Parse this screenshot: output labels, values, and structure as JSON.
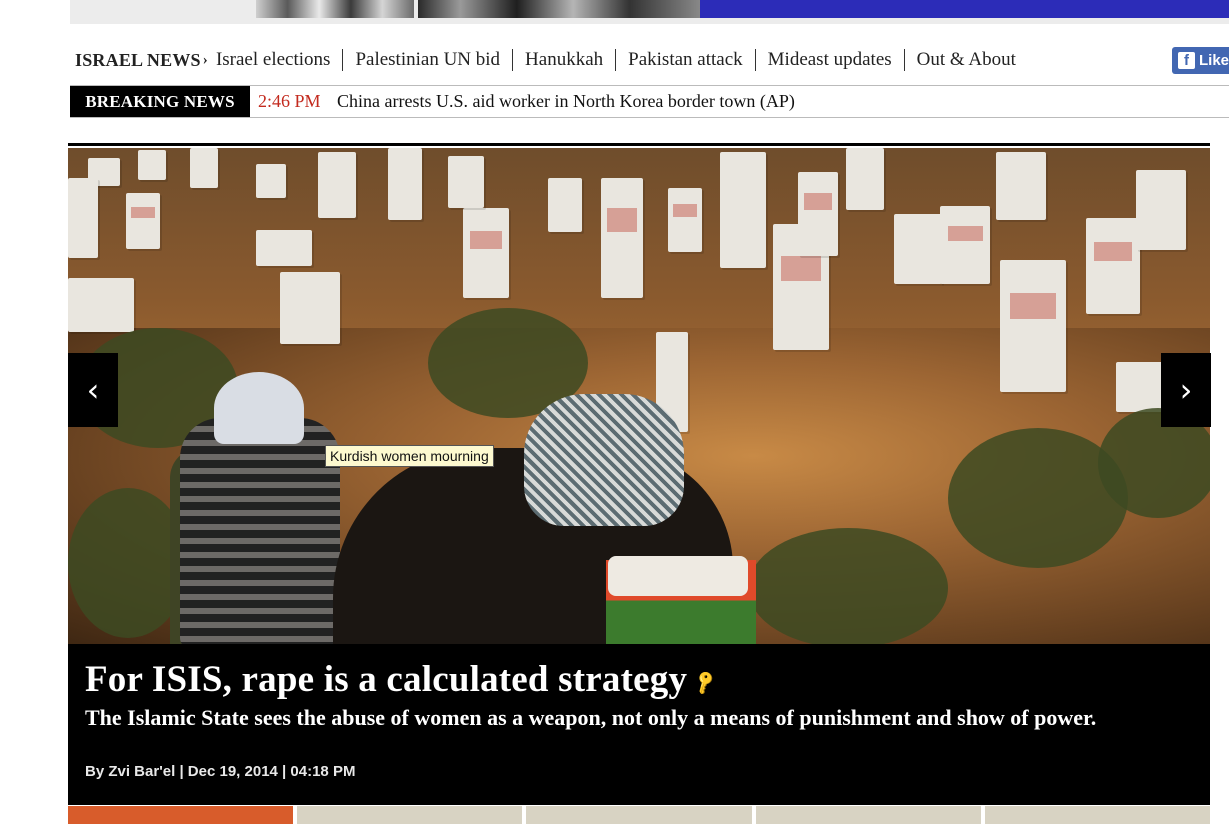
{
  "banner": {
    "text": ""
  },
  "nav": {
    "heading": "ISRAEL NEWS",
    "heading_chevron": "›",
    "items": [
      {
        "label": "Israel elections"
      },
      {
        "label": "Palestinian UN bid"
      },
      {
        "label": "Hanukkah"
      },
      {
        "label": "Pakistan attack"
      },
      {
        "label": "Mideast updates"
      },
      {
        "label": "Out & About"
      }
    ]
  },
  "social": {
    "like_label": "Like",
    "icon_glyph": "f"
  },
  "breaking": {
    "label": "BREAKING NEWS",
    "time": "2:46 PM",
    "headline": "China arrests U.S. aid worker in North Korea border town (AP)"
  },
  "hero": {
    "image_caption": "Kurdish women mourning",
    "prev_glyph": "‹",
    "next_glyph": "›"
  },
  "story": {
    "title": "For ISIS, rape is a calculated strategy",
    "key_glyph": "🔑",
    "dek": "The Islamic State sees the abuse of women as a weapon, not only a means of punishment and show of power.",
    "byline": "By Zvi Bar'el | Dec 19, 2014 | 04:18 PM"
  },
  "carousel": {
    "count": 5,
    "active_index": 0
  },
  "colors": {
    "breaking_time": "#c32a1e",
    "indicator_active": "#d85c2b",
    "indicator_inactive": "#d8d3c3",
    "facebook": "#4267b2"
  }
}
